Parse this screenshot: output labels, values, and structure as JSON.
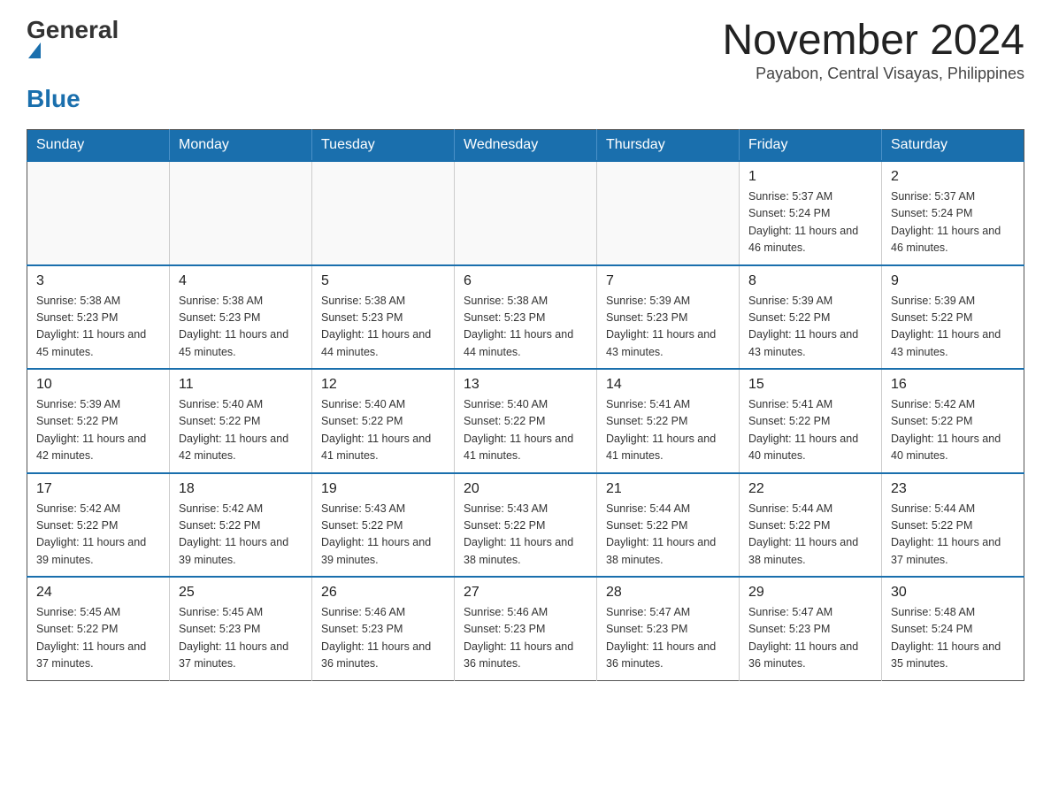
{
  "header": {
    "logo_general": "General",
    "logo_blue": "Blue",
    "title": "November 2024",
    "subtitle": "Payabon, Central Visayas, Philippines"
  },
  "days_of_week": [
    "Sunday",
    "Monday",
    "Tuesday",
    "Wednesday",
    "Thursday",
    "Friday",
    "Saturday"
  ],
  "weeks": [
    [
      {
        "day": "",
        "info": ""
      },
      {
        "day": "",
        "info": ""
      },
      {
        "day": "",
        "info": ""
      },
      {
        "day": "",
        "info": ""
      },
      {
        "day": "",
        "info": ""
      },
      {
        "day": "1",
        "info": "Sunrise: 5:37 AM\nSunset: 5:24 PM\nDaylight: 11 hours and 46 minutes."
      },
      {
        "day": "2",
        "info": "Sunrise: 5:37 AM\nSunset: 5:24 PM\nDaylight: 11 hours and 46 minutes."
      }
    ],
    [
      {
        "day": "3",
        "info": "Sunrise: 5:38 AM\nSunset: 5:23 PM\nDaylight: 11 hours and 45 minutes."
      },
      {
        "day": "4",
        "info": "Sunrise: 5:38 AM\nSunset: 5:23 PM\nDaylight: 11 hours and 45 minutes."
      },
      {
        "day": "5",
        "info": "Sunrise: 5:38 AM\nSunset: 5:23 PM\nDaylight: 11 hours and 44 minutes."
      },
      {
        "day": "6",
        "info": "Sunrise: 5:38 AM\nSunset: 5:23 PM\nDaylight: 11 hours and 44 minutes."
      },
      {
        "day": "7",
        "info": "Sunrise: 5:39 AM\nSunset: 5:23 PM\nDaylight: 11 hours and 43 minutes."
      },
      {
        "day": "8",
        "info": "Sunrise: 5:39 AM\nSunset: 5:22 PM\nDaylight: 11 hours and 43 minutes."
      },
      {
        "day": "9",
        "info": "Sunrise: 5:39 AM\nSunset: 5:22 PM\nDaylight: 11 hours and 43 minutes."
      }
    ],
    [
      {
        "day": "10",
        "info": "Sunrise: 5:39 AM\nSunset: 5:22 PM\nDaylight: 11 hours and 42 minutes."
      },
      {
        "day": "11",
        "info": "Sunrise: 5:40 AM\nSunset: 5:22 PM\nDaylight: 11 hours and 42 minutes."
      },
      {
        "day": "12",
        "info": "Sunrise: 5:40 AM\nSunset: 5:22 PM\nDaylight: 11 hours and 41 minutes."
      },
      {
        "day": "13",
        "info": "Sunrise: 5:40 AM\nSunset: 5:22 PM\nDaylight: 11 hours and 41 minutes."
      },
      {
        "day": "14",
        "info": "Sunrise: 5:41 AM\nSunset: 5:22 PM\nDaylight: 11 hours and 41 minutes."
      },
      {
        "day": "15",
        "info": "Sunrise: 5:41 AM\nSunset: 5:22 PM\nDaylight: 11 hours and 40 minutes."
      },
      {
        "day": "16",
        "info": "Sunrise: 5:42 AM\nSunset: 5:22 PM\nDaylight: 11 hours and 40 minutes."
      }
    ],
    [
      {
        "day": "17",
        "info": "Sunrise: 5:42 AM\nSunset: 5:22 PM\nDaylight: 11 hours and 39 minutes."
      },
      {
        "day": "18",
        "info": "Sunrise: 5:42 AM\nSunset: 5:22 PM\nDaylight: 11 hours and 39 minutes."
      },
      {
        "day": "19",
        "info": "Sunrise: 5:43 AM\nSunset: 5:22 PM\nDaylight: 11 hours and 39 minutes."
      },
      {
        "day": "20",
        "info": "Sunrise: 5:43 AM\nSunset: 5:22 PM\nDaylight: 11 hours and 38 minutes."
      },
      {
        "day": "21",
        "info": "Sunrise: 5:44 AM\nSunset: 5:22 PM\nDaylight: 11 hours and 38 minutes."
      },
      {
        "day": "22",
        "info": "Sunrise: 5:44 AM\nSunset: 5:22 PM\nDaylight: 11 hours and 38 minutes."
      },
      {
        "day": "23",
        "info": "Sunrise: 5:44 AM\nSunset: 5:22 PM\nDaylight: 11 hours and 37 minutes."
      }
    ],
    [
      {
        "day": "24",
        "info": "Sunrise: 5:45 AM\nSunset: 5:22 PM\nDaylight: 11 hours and 37 minutes."
      },
      {
        "day": "25",
        "info": "Sunrise: 5:45 AM\nSunset: 5:23 PM\nDaylight: 11 hours and 37 minutes."
      },
      {
        "day": "26",
        "info": "Sunrise: 5:46 AM\nSunset: 5:23 PM\nDaylight: 11 hours and 36 minutes."
      },
      {
        "day": "27",
        "info": "Sunrise: 5:46 AM\nSunset: 5:23 PM\nDaylight: 11 hours and 36 minutes."
      },
      {
        "day": "28",
        "info": "Sunrise: 5:47 AM\nSunset: 5:23 PM\nDaylight: 11 hours and 36 minutes."
      },
      {
        "day": "29",
        "info": "Sunrise: 5:47 AM\nSunset: 5:23 PM\nDaylight: 11 hours and 36 minutes."
      },
      {
        "day": "30",
        "info": "Sunrise: 5:48 AM\nSunset: 5:24 PM\nDaylight: 11 hours and 35 minutes."
      }
    ]
  ]
}
